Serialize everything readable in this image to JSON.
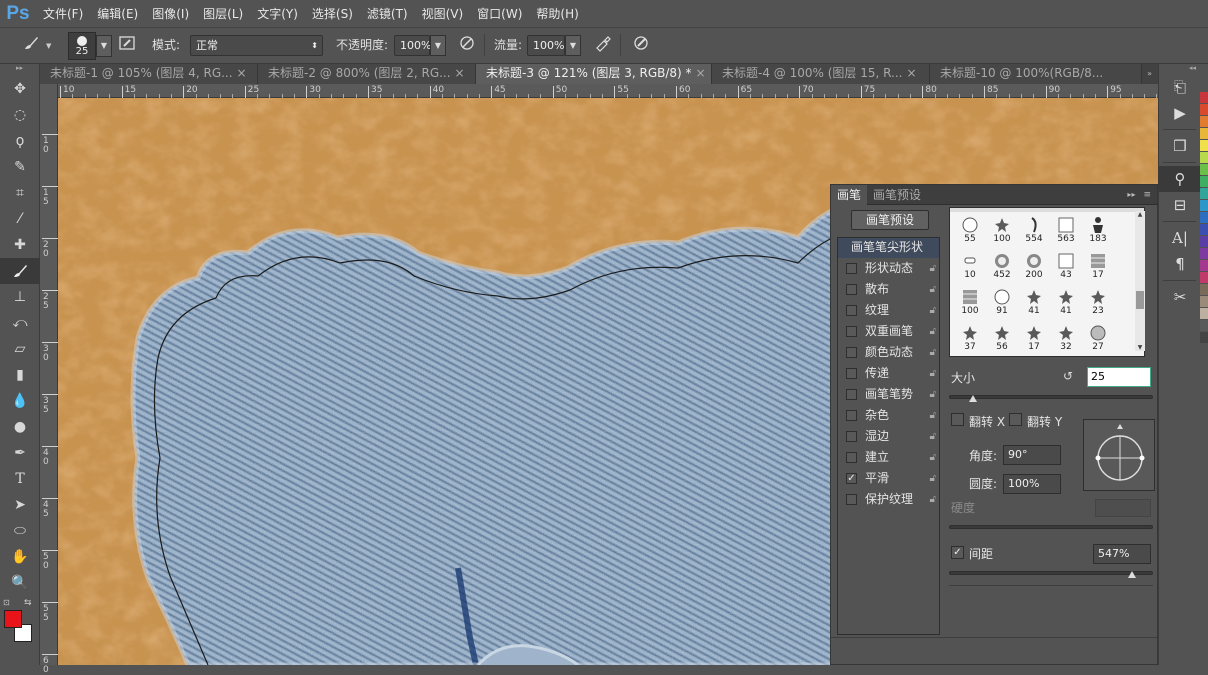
{
  "app": {
    "logo": "Ps"
  },
  "menu": [
    "文件(F)",
    "编辑(E)",
    "图像(I)",
    "图层(L)",
    "文字(Y)",
    "选择(S)",
    "滤镜(T)",
    "视图(V)",
    "窗口(W)",
    "帮助(H)"
  ],
  "options": {
    "brush_size": "25",
    "mode_label": "模式:",
    "mode_value": "正常",
    "opacity_label": "不透明度:",
    "opacity_value": "100%",
    "flow_label": "流量:",
    "flow_value": "100%"
  },
  "tabs": [
    {
      "label": "未标题-1 @ 105% (图层 4, RG...",
      "active": false
    },
    {
      "label": "未标题-2 @ 800% (图层 2, RG...",
      "active": false
    },
    {
      "label": "未标题-3 @ 121% (图层 3, RGB/8) *",
      "active": true
    },
    {
      "label": "未标题-4 @ 100% (图层 15, R...",
      "active": false
    },
    {
      "label": "未标题-10 @ 100%(RGB/8...",
      "active": false
    }
  ],
  "ruler_h": [
    "10",
    "15",
    "20",
    "25",
    "30",
    "35",
    "40",
    "45",
    "50",
    "55",
    "60",
    "65",
    "70",
    "75",
    "80",
    "85",
    "90",
    "95"
  ],
  "ruler_v": [
    "1\n0",
    "1\n5",
    "2\n0",
    "2\n5",
    "3\n0",
    "3\n5",
    "4\n0",
    "4\n5",
    "5\n0",
    "5\n5",
    "6\n0"
  ],
  "tools": [
    "move-tool",
    "marquee-tool",
    "lasso-tool",
    "quick-select-tool",
    "crop-tool",
    "eyedropper-tool",
    "healing-tool",
    "brush-tool",
    "stamp-tool",
    "history-brush-tool",
    "eraser-tool",
    "gradient-tool",
    "blur-tool",
    "dodge-tool",
    "pen-tool",
    "type-tool",
    "path-select-tool",
    "ellipse-tool",
    "hand-tool",
    "zoom-tool"
  ],
  "colors": {
    "foreground": "#e8141a",
    "background": "#ffffff",
    "canvas_leather": "#c8924f",
    "denim": "#7e97b2"
  },
  "brush_panel": {
    "tab_active": "画笔",
    "tab_other": "画笔预设",
    "preset_button": "画笔预设",
    "header_item": "画笔笔尖形状",
    "options": [
      {
        "label": "形状动态",
        "checked": false,
        "lock": true
      },
      {
        "label": "散布",
        "checked": false,
        "lock": true
      },
      {
        "label": "纹理",
        "checked": false,
        "lock": true
      },
      {
        "label": "双重画笔",
        "checked": false,
        "lock": true
      },
      {
        "label": "颜色动态",
        "checked": false,
        "lock": true
      },
      {
        "label": "传递",
        "checked": false,
        "lock": true
      },
      {
        "label": "画笔笔势",
        "checked": false,
        "lock": true
      },
      {
        "label": "杂色",
        "checked": false,
        "lock": true
      },
      {
        "label": "湿边",
        "checked": false,
        "lock": true
      },
      {
        "label": "建立",
        "checked": false,
        "lock": true
      },
      {
        "label": "平滑",
        "checked": true,
        "lock": true
      },
      {
        "label": "保护纹理",
        "checked": false,
        "lock": true
      }
    ],
    "preset_numbers": [
      "55",
      "100",
      "554",
      "563",
      "183",
      "10",
      "452",
      "200",
      "43",
      "17",
      "100",
      "91",
      "41",
      "41",
      "23",
      "37",
      "56",
      "17",
      "32",
      "27"
    ],
    "size_label": "大小",
    "size_value": "25",
    "flip_x_label": "翻转 X",
    "flip_y_label": "翻转 Y",
    "angle_label": "角度:",
    "angle_value": "90°",
    "roundness_label": "圆度:",
    "roundness_value": "100%",
    "hardness_label": "硬度",
    "spacing_label": "间距",
    "spacing_checked": true,
    "spacing_value": "547%"
  }
}
